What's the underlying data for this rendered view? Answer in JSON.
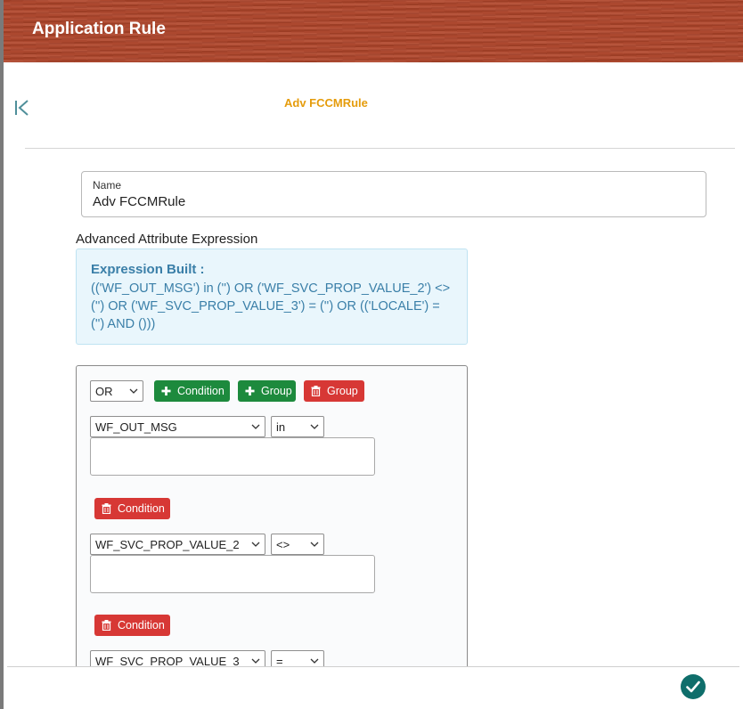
{
  "dialog": {
    "title": "Application Rule"
  },
  "header": {
    "record_name": "Adv FCCMRule",
    "back_icon": "skip-to-first-icon"
  },
  "name_field": {
    "label": "Name",
    "value": "Adv FCCMRule"
  },
  "advanced": {
    "label": "Advanced Attribute Expression",
    "expression_heading": "Expression Built :",
    "expression_text": "(('WF_OUT_MSG') in ('') OR ('WF_SVC_PROP_VALUE_2') <> ('') OR ('WF_SVC_PROP_VALUE_3') = ('') OR (('LOCALE') = ('') AND ()))"
  },
  "builder": {
    "group_operator": "OR",
    "add_condition_label": "Condition",
    "add_group_label": "Group",
    "delete_group_label": "Group",
    "delete_condition_label": "Condition",
    "conditions": [
      {
        "attribute": "WF_OUT_MSG",
        "operator": "in"
      },
      {
        "attribute": "WF_SVC_PROP_VALUE_2",
        "operator": "<>"
      },
      {
        "attribute": "WF_SVC_PROP_VALUE_3",
        "operator": "="
      }
    ]
  },
  "colors": {
    "titlebar": "#b0452a",
    "accent_text": "#e59c0c",
    "expression_text": "#3a7fa8",
    "add_button": "#1d8a3d",
    "delete_button": "#d73835",
    "confirm_button": "#0f6e6b"
  },
  "footer": {
    "confirm_icon": "check-circle-icon"
  }
}
